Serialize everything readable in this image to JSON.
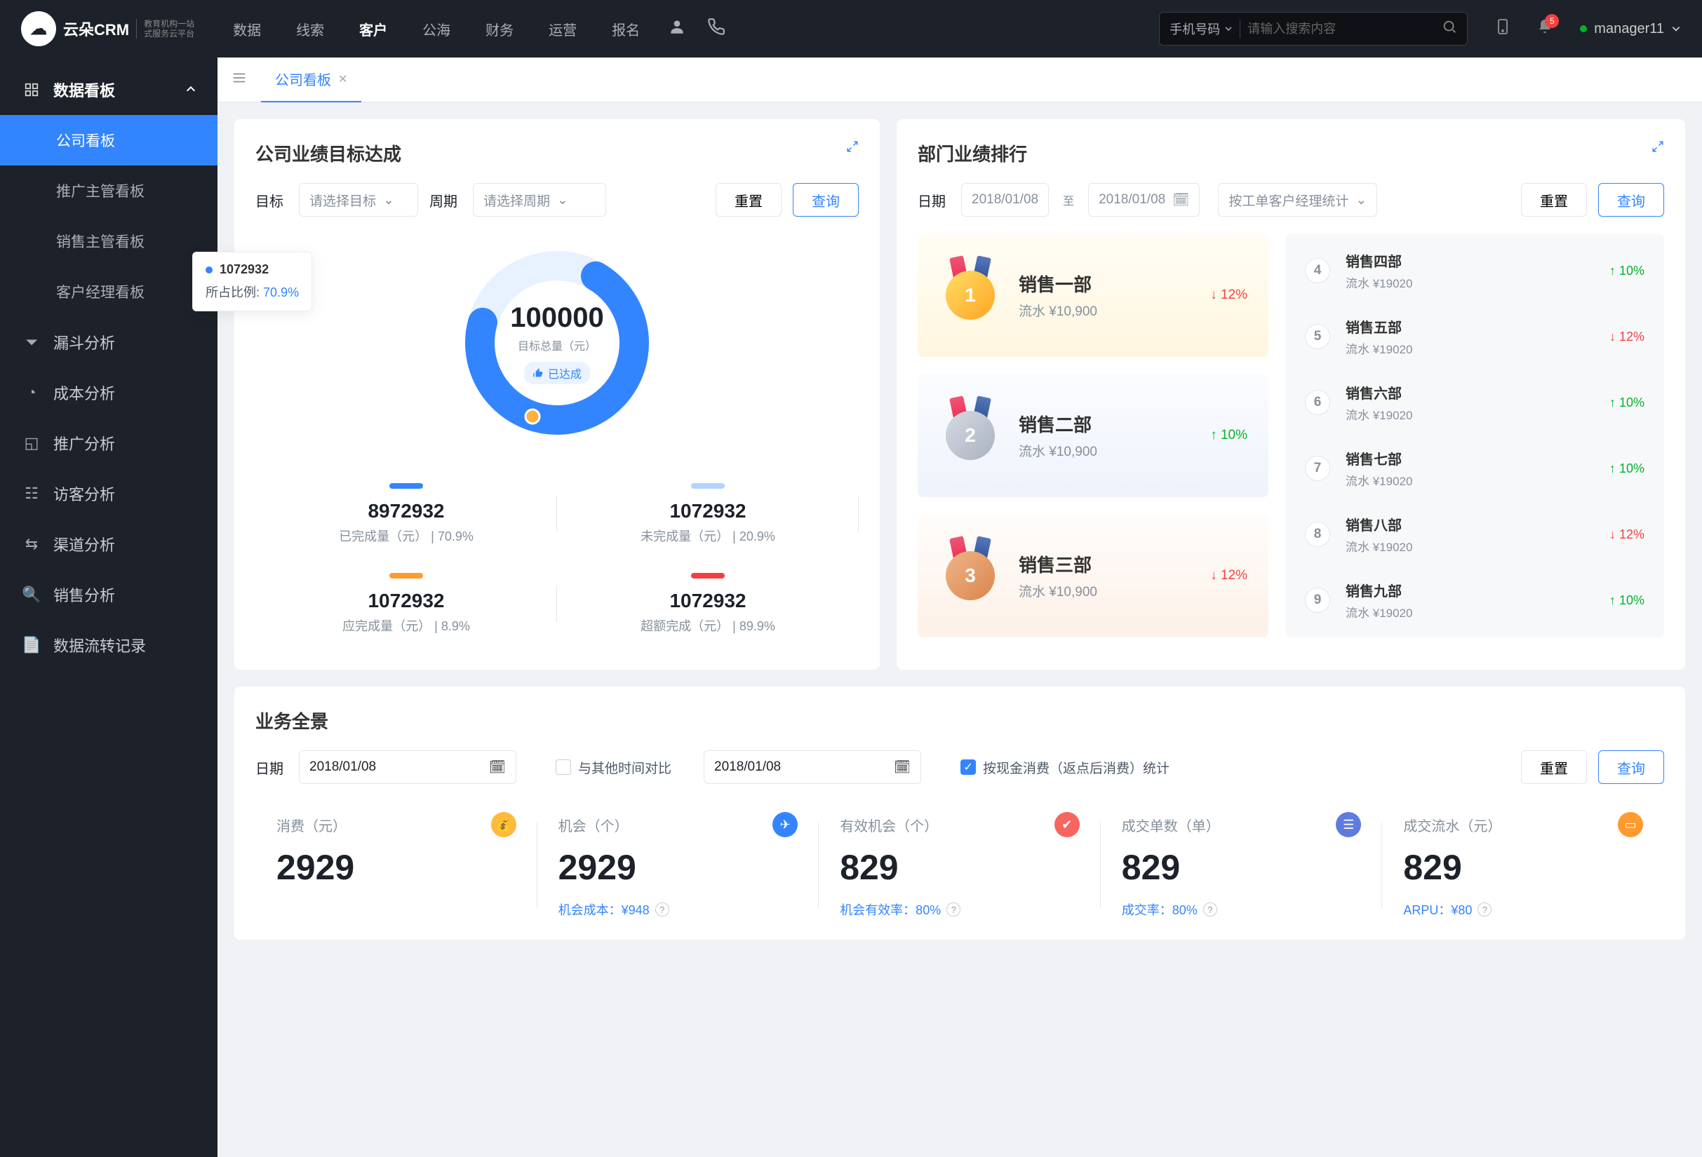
{
  "brand": {
    "name": "云朵CRM",
    "sub_l1": "教育机构一站",
    "sub_l2": "式服务云平台"
  },
  "nav": {
    "items": [
      "数据",
      "线索",
      "客户",
      "公海",
      "财务",
      "运营",
      "报名"
    ],
    "active": 2
  },
  "search": {
    "type": "手机号码",
    "placeholder": "请输入搜索内容"
  },
  "notif": {
    "count": "5"
  },
  "user": {
    "name": "manager11"
  },
  "sidebar": {
    "group": {
      "label": "数据看板"
    },
    "subs": [
      "公司看板",
      "推广主管看板",
      "销售主管看板",
      "客户经理看板"
    ],
    "items": [
      "漏斗分析",
      "成本分析",
      "推广分析",
      "访客分析",
      "渠道分析",
      "销售分析",
      "数据流转记录"
    ]
  },
  "tab": {
    "label": "公司看板"
  },
  "cardA": {
    "title": "公司业绩目标达成",
    "labels": {
      "target": "目标",
      "period": "周期",
      "target_ph": "请选择目标",
      "period_ph": "请选择周期"
    },
    "btn_reset": "重置",
    "btn_query": "查询",
    "total": "100000",
    "total_lab": "目标总量（元）",
    "achieved": "已达成",
    "tooltip": {
      "val": "1072932",
      "lab": "所占比例:",
      "pct": "70.9%"
    },
    "stats": [
      {
        "bar": "#3385ff",
        "val": "8972932",
        "lab": "已完成量（元） | 70.9%"
      },
      {
        "bar": "#b3d3ff",
        "val": "1072932",
        "lab": "未完成量（元） | 20.9%"
      },
      {
        "bar": "#ff9a2e",
        "val": "1072932",
        "lab": "应完成量（元） | 8.9%"
      },
      {
        "bar": "#f53f3f",
        "val": "1072932",
        "lab": "超额完成（元） | 89.9%"
      }
    ]
  },
  "cardB": {
    "title": "部门业绩排行",
    "labels": {
      "date": "日期",
      "to": "至",
      "opt": "按工单客户经理统计"
    },
    "date": "2018/01/08",
    "btn_reset": "重置",
    "btn_query": "查询",
    "podium": [
      {
        "rank": "1",
        "name": "销售一部",
        "sub": "流水 ¥10,900",
        "trend": "12%",
        "dir": "down",
        "bg": "linear-gradient(180deg,#fffdf5,#fff6de)",
        "medal": "linear-gradient(135deg,#ffdd65,#ffa522)"
      },
      {
        "rank": "2",
        "name": "销售二部",
        "sub": "流水 ¥10,900",
        "trend": "10%",
        "dir": "up",
        "bg": "linear-gradient(180deg,#fbfcfe,#eef3fc)",
        "medal": "linear-gradient(135deg,#d6dbe3,#a9b2c0)"
      },
      {
        "rank": "3",
        "name": "销售三部",
        "sub": "流水 ¥10,900",
        "trend": "12%",
        "dir": "down",
        "bg": "linear-gradient(180deg,#fffcfa,#fdf1e8)",
        "medal": "linear-gradient(135deg,#f0b489,#d9864c)"
      }
    ],
    "list": [
      {
        "num": "4",
        "name": "销售四部",
        "sub": "流水 ¥19020",
        "trend": "10%",
        "dir": "up"
      },
      {
        "num": "5",
        "name": "销售五部",
        "sub": "流水 ¥19020",
        "trend": "12%",
        "dir": "down"
      },
      {
        "num": "6",
        "name": "销售六部",
        "sub": "流水 ¥19020",
        "trend": "10%",
        "dir": "up"
      },
      {
        "num": "7",
        "name": "销售七部",
        "sub": "流水 ¥19020",
        "trend": "10%",
        "dir": "up"
      },
      {
        "num": "8",
        "name": "销售八部",
        "sub": "流水 ¥19020",
        "trend": "12%",
        "dir": "down"
      },
      {
        "num": "9",
        "name": "销售九部",
        "sub": "流水 ¥19020",
        "trend": "10%",
        "dir": "up"
      }
    ]
  },
  "cardC": {
    "title": "业务全景",
    "labels": {
      "date": "日期",
      "compare": "与其他时间对比",
      "stat": "按现金消费（返点后消费）统计"
    },
    "date": "2018/01/08",
    "btn_reset": "重置",
    "btn_query": "查询",
    "kpis": [
      {
        "title": "消费（元）",
        "val": "2929",
        "ic": "💰",
        "bg": "#fdba3d",
        "foot": ""
      },
      {
        "title": "机会（个）",
        "val": "2929",
        "ic": "✈",
        "bg": "#3385ff",
        "foot": "机会成本：¥948"
      },
      {
        "title": "有效机会（个）",
        "val": "829",
        "ic": "✔",
        "bg": "#f76560",
        "foot": "机会有效率：80%"
      },
      {
        "title": "成交单数（单）",
        "val": "829",
        "ic": "☰",
        "bg": "#5e7ce0",
        "foot": "成交率：80%"
      },
      {
        "title": "成交流水（元）",
        "val": "829",
        "ic": "▭",
        "bg": "#ff9a2e",
        "foot": "ARPU：¥80"
      }
    ]
  },
  "chart_data": {
    "type": "pie",
    "title": "目标达成环形图",
    "total": 100000,
    "series": [
      {
        "name": "已完成",
        "value": 70.9,
        "color": "#3385ff"
      },
      {
        "name": "未完成",
        "value": 29.1,
        "color": "#e8f1ff"
      }
    ],
    "highlight": {
      "value": 1072932,
      "pct": 70.9
    }
  }
}
